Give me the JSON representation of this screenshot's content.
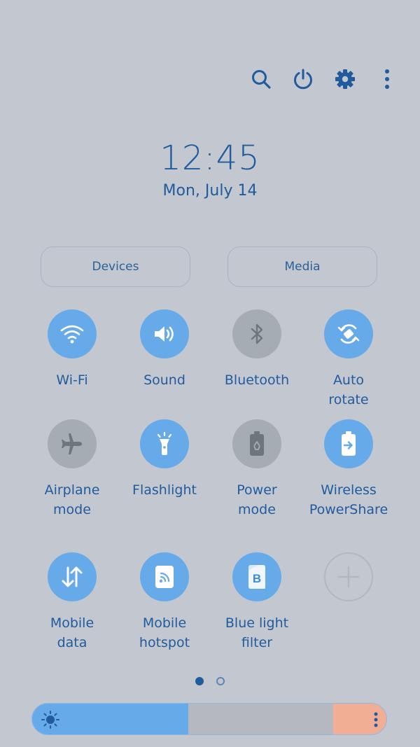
{
  "topbar": {
    "icons": [
      "search-icon",
      "power-icon",
      "settings-icon",
      "more-vertical-icon"
    ]
  },
  "clock": {
    "time": "12:45",
    "date": "Mon, July 14"
  },
  "buttons": {
    "devices": "Devices",
    "media": "Media"
  },
  "tiles": [
    {
      "label": "Wi-Fi",
      "icon": "wifi-icon",
      "state": "on"
    },
    {
      "label": "Sound",
      "icon": "sound-icon",
      "state": "on"
    },
    {
      "label": "Bluetooth",
      "icon": "bluetooth-icon",
      "state": "off"
    },
    {
      "label": "Auto\nrotate",
      "icon": "auto-rotate-icon",
      "state": "on"
    },
    {
      "label": "Airplane\nmode",
      "icon": "airplane-icon",
      "state": "off"
    },
    {
      "label": "Flashlight",
      "icon": "flashlight-icon",
      "state": "on"
    },
    {
      "label": "Power\nmode",
      "icon": "power-mode-icon",
      "state": "off"
    },
    {
      "label": "Wireless\nPowerShare",
      "icon": "wireless-powershare-icon",
      "state": "on"
    },
    {
      "label": "Mobile\ndata",
      "icon": "mobile-data-icon",
      "state": "on"
    },
    {
      "label": "Mobile\nhotspot",
      "icon": "hotspot-icon",
      "state": "on"
    },
    {
      "label": "Blue light\nfilter",
      "icon": "blue-light-filter-icon",
      "state": "on"
    },
    {
      "label": "",
      "icon": "add-icon",
      "state": "add"
    }
  ],
  "pager": {
    "pages": 2,
    "current": 1
  },
  "brightness": {
    "level": 0.44,
    "icon": "sun-icon"
  },
  "colors": {
    "background": "#c3c8d0",
    "accent": "#66aaea",
    "text": "#1f5b9d",
    "tile_off": "#a6acb3",
    "brightness_end": "#f2ae95"
  }
}
